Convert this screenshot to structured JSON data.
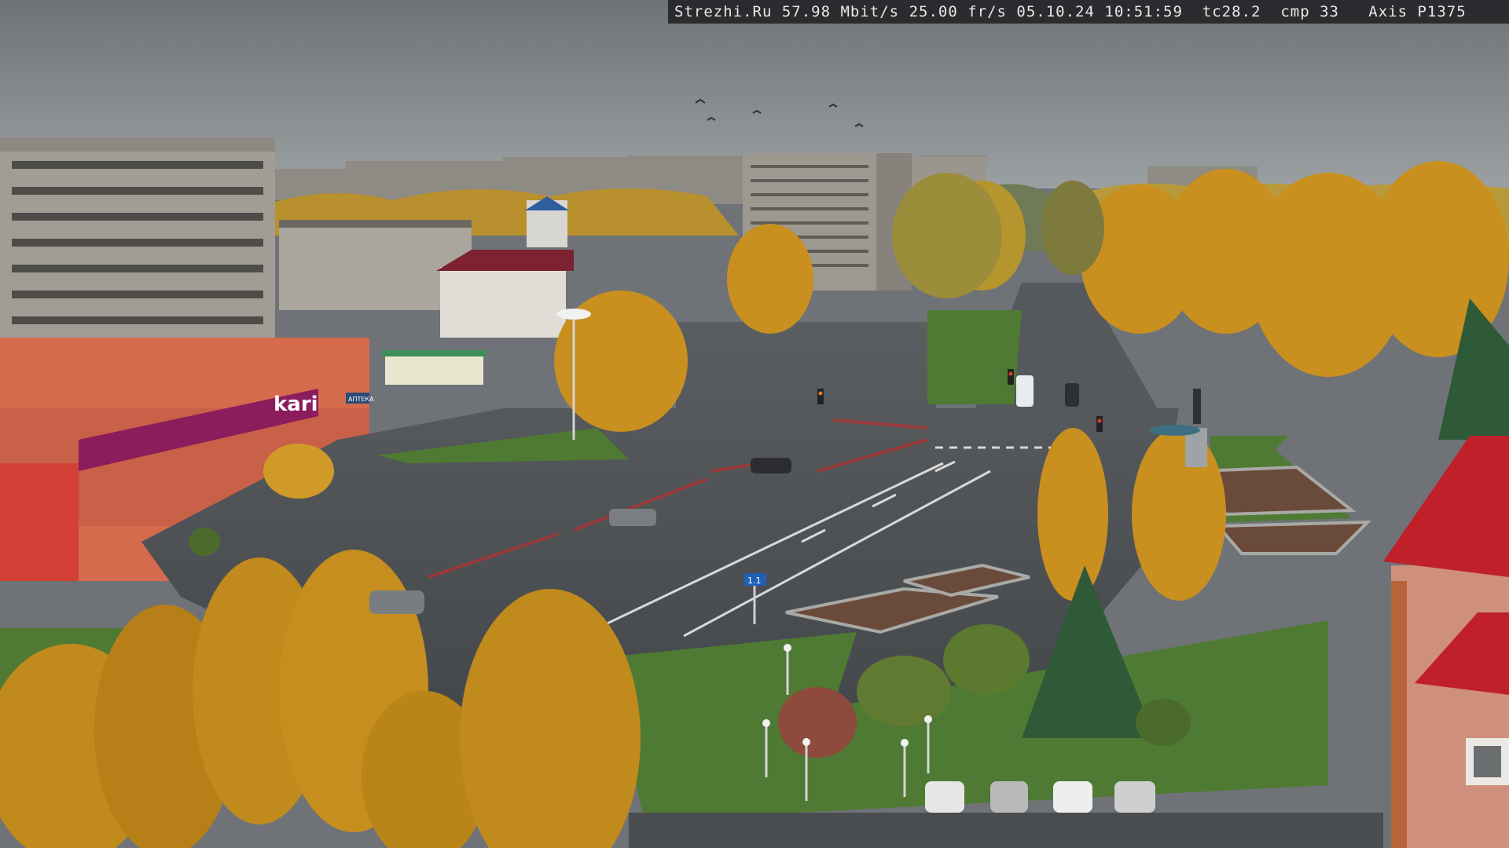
{
  "overlay": {
    "site": "Strezhi.Ru",
    "bitrate": "57.98 Mbit/s",
    "framerate": "25.00 fr/s",
    "date": "05.10.24",
    "time": "10:51:59",
    "tc": "tc28.2",
    "cmp": "cmp 33",
    "camera_model": "Axis P1375"
  },
  "signs": {
    "store_brand": "kari",
    "pharmacy": "АПТЕКА",
    "route_sign": "1.1"
  },
  "colors": {
    "sky": "#8a8f93",
    "autumn_foliage": "#c9901f",
    "grass": "#4f7a33",
    "asphalt": "#4d5154",
    "store_banner": "#8b1d5c",
    "red_roof": "#c0202a"
  },
  "icons": {
    "traffic_light": "traffic-light-icon",
    "street_lamp": "street-lamp-icon",
    "car": "car-icon",
    "bird": "bird-icon"
  }
}
